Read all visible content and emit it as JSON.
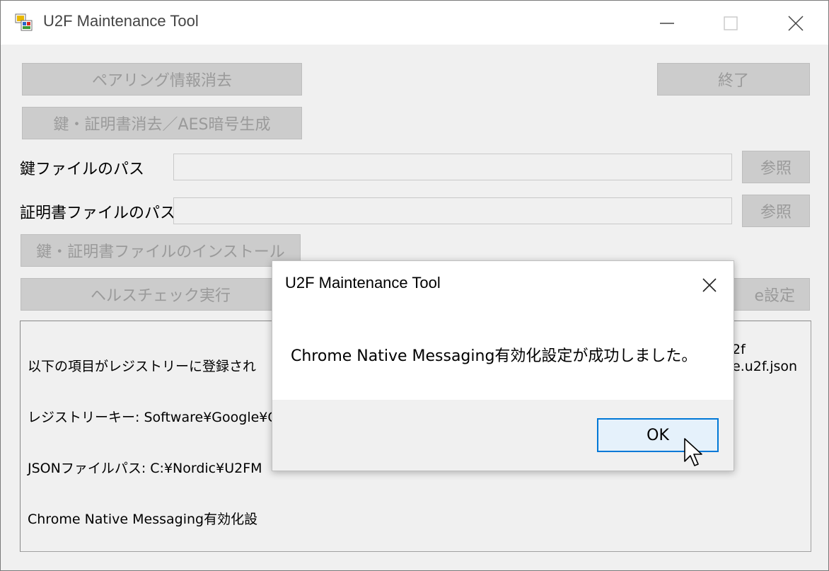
{
  "window": {
    "title": "U2F Maintenance Tool",
    "controls": {
      "minimize": "minimize",
      "maximize": "maximize",
      "close": "close"
    }
  },
  "main": {
    "buttons": {
      "erase_pairing": "ペアリング情報消去",
      "exit": "終了",
      "erase_keys": "鍵・証明書消去／AES暗号生成",
      "browse_key": "参照",
      "browse_cert": "参照",
      "install_files": "鍵・証明書ファイルのインストール",
      "health_check": "ヘルスチェック実行",
      "chrome_setting_partial": "e設定"
    },
    "labels": {
      "key_path": "鍵ファイルのパス",
      "cert_path": "証明書ファイルのパス"
    },
    "fields": {
      "key_path_value": "",
      "cert_path_value": ""
    },
    "log": {
      "lines": [
        "以下の項目がレジストリーに登録され",
        "レジストリーキー: Software¥Google¥C",
        "JSONファイルパス: C:¥Nordic¥U2FM",
        "Chrome Native Messaging有効化設"
      ],
      "right_fragments": [
        "2f",
        "e.u2f.json"
      ]
    }
  },
  "dialog": {
    "title": "U2F Maintenance Tool",
    "message": "Chrome Native Messaging有効化設定が成功しました。",
    "ok_label": "OK"
  },
  "colors": {
    "accent": "#0078d7",
    "ok_fill": "#e5f1fb",
    "disabled_button": "#cccccc",
    "disabled_text": "#9a9a9a",
    "window_bg": "#f0f0f0"
  }
}
